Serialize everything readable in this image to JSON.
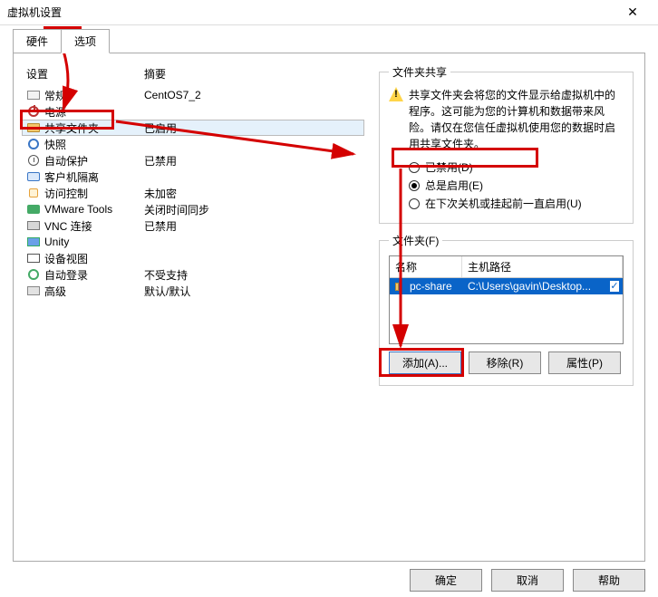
{
  "window": {
    "title": "虚拟机设置"
  },
  "tabs": {
    "hardware": "硬件",
    "options": "选项"
  },
  "list": {
    "header_setting": "设置",
    "header_summary": "摘要",
    "rows": [
      {
        "name": "general",
        "label": "常规",
        "summary": "CentOS7_2"
      },
      {
        "name": "power",
        "label": "电源",
        "summary": ""
      },
      {
        "name": "shared-folder",
        "label": "共享文件夹",
        "summary": "已启用"
      },
      {
        "name": "snapshot",
        "label": "快照",
        "summary": ""
      },
      {
        "name": "autoprotect",
        "label": "自动保护",
        "summary": "已禁用"
      },
      {
        "name": "guest-iso",
        "label": "客户机隔离",
        "summary": ""
      },
      {
        "name": "access",
        "label": "访问控制",
        "summary": "未加密"
      },
      {
        "name": "vmware-tools",
        "label": "VMware Tools",
        "summary": "关闭时间同步"
      },
      {
        "name": "vnc",
        "label": "VNC 连接",
        "summary": "已禁用"
      },
      {
        "name": "unity",
        "label": "Unity",
        "summary": ""
      },
      {
        "name": "device-view",
        "label": "设备视图",
        "summary": ""
      },
      {
        "name": "autologin",
        "label": "自动登录",
        "summary": "不受支持"
      },
      {
        "name": "advanced",
        "label": "高级",
        "summary": "默认/默认"
      }
    ]
  },
  "share": {
    "group_label": "文件夹共享",
    "warning": "共享文件夹会将您的文件显示给虚拟机中的程序。这可能为您的计算机和数据带来风险。请仅在您信任虚拟机使用您的数据时启用共享文件夹。",
    "radio_disabled": "已禁用(D)",
    "radio_always": "总是启用(E)",
    "radio_until_next": "在下次关机或挂起前一直启用(U)"
  },
  "folders": {
    "group_label": "文件夹(F)",
    "col_name": "名称",
    "col_path": "主机路径",
    "rows": [
      {
        "name": "pc-share",
        "path": "C:\\Users\\gavin\\Desktop..."
      }
    ],
    "btn_add": "添加(A)...",
    "btn_remove": "移除(R)",
    "btn_props": "属性(P)"
  },
  "footer": {
    "ok": "确定",
    "cancel": "取消",
    "help": "帮助"
  }
}
